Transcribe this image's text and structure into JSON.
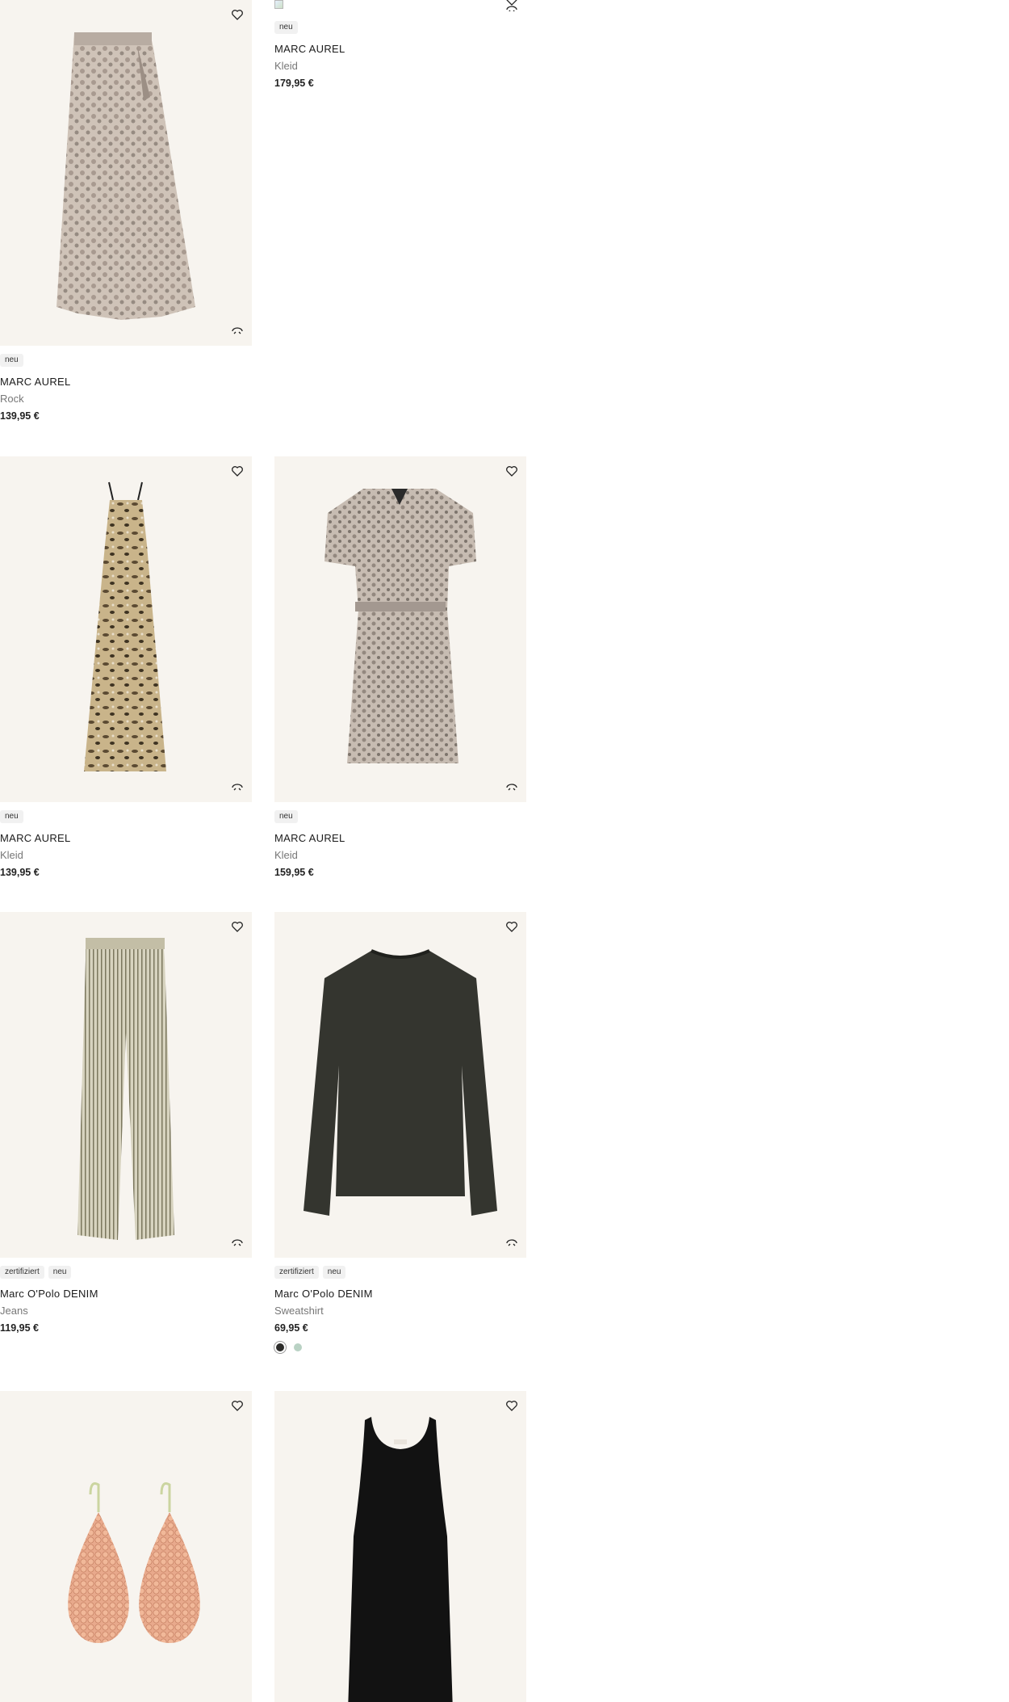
{
  "products": [
    {
      "badges": [
        "neu"
      ],
      "brand": "MARC AUREL",
      "category": "Rock",
      "price": "139,95 €"
    },
    {
      "badges": [
        "neu"
      ],
      "brand": "MARC AUREL",
      "category": "Kleid",
      "price": "179,95 €"
    },
    {
      "badges": [
        "neu"
      ],
      "brand": "MARC AUREL",
      "category": "Kleid",
      "price": "139,95 €"
    },
    {
      "badges": [
        "neu"
      ],
      "brand": "MARC AUREL",
      "category": "Kleid",
      "price": "159,95 €"
    },
    {
      "badges": [
        "zertifiziert",
        "neu"
      ],
      "brand": "Marc O'Polo DENIM",
      "category": "Jeans",
      "price": "119,95 €"
    },
    {
      "badges": [
        "zertifiziert",
        "neu"
      ],
      "brand": "Marc O'Polo DENIM",
      "category": "Sweatshirt",
      "price": "69,95 €",
      "swatches": [
        "#2c2c2a",
        "#b9d2c4"
      ]
    }
  ],
  "icons": {
    "wishlist": "heart-icon",
    "similar": "similar-items-icon"
  },
  "colors": {
    "image_background": "#f7f4ef",
    "badge_background": "#f1f1f1"
  }
}
